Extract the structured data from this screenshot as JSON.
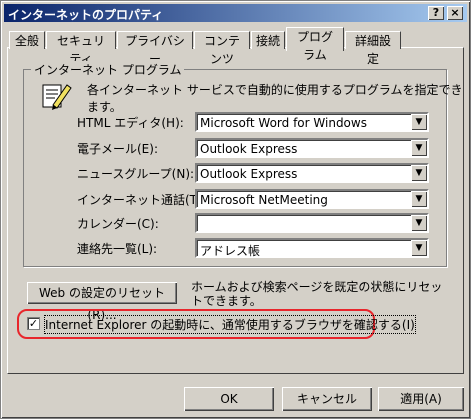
{
  "window": {
    "title": "インターネットのプロパティ",
    "help": "?",
    "close": "×"
  },
  "tabs": [
    "全般",
    "セキュリティ",
    "プライバシー",
    "コンテンツ",
    "接続",
    "プログラム",
    "詳細設定"
  ],
  "group": {
    "label": "インターネット プログラム",
    "description": "各インターネット サービスで自動的に使用するプログラムを指定できます。"
  },
  "programs": [
    {
      "label": "HTML エディタ(H):",
      "value": "Microsoft Word for Windows"
    },
    {
      "label": "電子メール(E):",
      "value": "Outlook Express"
    },
    {
      "label": "ニュースグループ(N):",
      "value": "Outlook Express"
    },
    {
      "label": "インターネット通話(T):",
      "value": "Microsoft NetMeeting"
    },
    {
      "label": "カレンダー(C):",
      "value": ""
    },
    {
      "label": "連絡先一覧(L):",
      "value": "アドレス帳"
    }
  ],
  "reset": {
    "button": "Web の設定のリセット(R)...",
    "description": "ホームおよび検索ページを既定の状態にリセットできます。"
  },
  "checkbox": {
    "label": "Internet Explorer の起動時に、通常使用するブラウザを確認する(I)",
    "checked": true,
    "mark": "✓"
  },
  "footer": {
    "ok": "OK",
    "cancel": "キャンセル",
    "apply": "適用(A)"
  },
  "icons": {
    "dropdown": "▼",
    "program_icon": "document-pen-icon"
  },
  "colors": {
    "titlebar": "#0a246a",
    "highlight": "#e8262c",
    "face": "#d4d0c8"
  }
}
